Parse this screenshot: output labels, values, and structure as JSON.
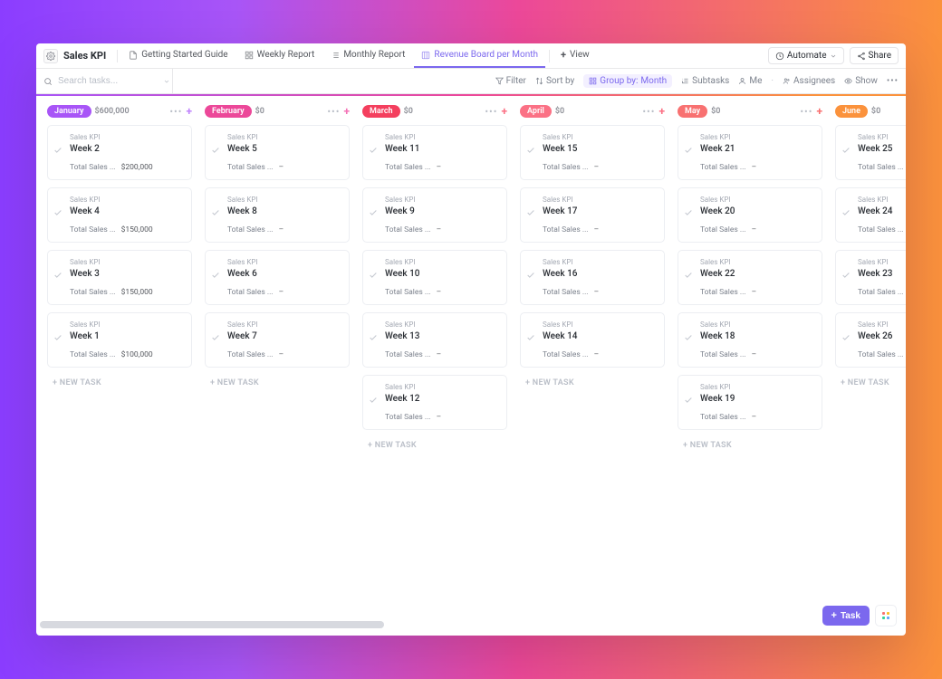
{
  "title": "Sales KPI",
  "tabs": [
    {
      "label": "Getting Started Guide",
      "active": false
    },
    {
      "label": "Weekly Report",
      "active": false
    },
    {
      "label": "Monthly Report",
      "active": false
    },
    {
      "label": "Revenue Board per Month",
      "active": true
    },
    {
      "label": "View",
      "active": false,
      "is_add": true
    }
  ],
  "top_right": {
    "automate": "Automate",
    "share": "Share"
  },
  "search": {
    "placeholder": "Search tasks..."
  },
  "toolbar": {
    "filter": "Filter",
    "sort": "Sort by",
    "group_prefix": "Group by:",
    "group_value": "Month",
    "subtasks": "Subtasks",
    "me": "Me",
    "assignees": "Assignees",
    "show": "Show"
  },
  "new_task_label": "+ NEW TASK",
  "task_fab": "Task",
  "columns": [
    {
      "name": "January",
      "amount": "$600,000",
      "color": "#a855f7",
      "plus": "#c084fc",
      "cards": [
        {
          "crumb": "Sales KPI",
          "title": "Week 2",
          "kvk": "Total Sales ...",
          "kvv": "$200,000"
        },
        {
          "crumb": "Sales KPI",
          "title": "Week 4",
          "kvk": "Total Sales ...",
          "kvv": "$150,000"
        },
        {
          "crumb": "Sales KPI",
          "title": "Week 3",
          "kvk": "Total Sales ...",
          "kvv": "$150,000"
        },
        {
          "crumb": "Sales KPI",
          "title": "Week 1",
          "kvk": "Total Sales ...",
          "kvv": "$100,000"
        }
      ],
      "show_new": true
    },
    {
      "name": "February",
      "amount": "$0",
      "color": "#ec4899",
      "plus": "#f472b6",
      "cards": [
        {
          "crumb": "Sales KPI",
          "title": "Week 5",
          "kvk": "Total Sales ...",
          "kvv": "–"
        },
        {
          "crumb": "Sales KPI",
          "title": "Week 8",
          "kvk": "Total Sales ...",
          "kvv": "–"
        },
        {
          "crumb": "Sales KPI",
          "title": "Week 6",
          "kvk": "Total Sales ...",
          "kvv": "–"
        },
        {
          "crumb": "Sales KPI",
          "title": "Week 7",
          "kvk": "Total Sales ...",
          "kvv": "–"
        }
      ],
      "show_new": true
    },
    {
      "name": "March",
      "amount": "$0",
      "color": "#f43f5e",
      "plus": "#fb7185",
      "cards": [
        {
          "crumb": "Sales KPI",
          "title": "Week 11",
          "kvk": "Total Sales ...",
          "kvv": "–"
        },
        {
          "crumb": "Sales KPI",
          "title": "Week 9",
          "kvk": "Total Sales ...",
          "kvv": "–"
        },
        {
          "crumb": "Sales KPI",
          "title": "Week 10",
          "kvk": "Total Sales ...",
          "kvv": "–"
        },
        {
          "crumb": "Sales KPI",
          "title": "Week 13",
          "kvk": "Total Sales ...",
          "kvv": "–"
        },
        {
          "crumb": "Sales KPI",
          "title": "Week 12",
          "kvk": "Total Sales ...",
          "kvv": "–"
        }
      ],
      "show_new": true
    },
    {
      "name": "April",
      "amount": "$0",
      "color": "#fb7185",
      "plus": "#fb7185",
      "cards": [
        {
          "crumb": "Sales KPI",
          "title": "Week 15",
          "kvk": "Total Sales ...",
          "kvv": "–"
        },
        {
          "crumb": "Sales KPI",
          "title": "Week 17",
          "kvk": "Total Sales ...",
          "kvv": "–"
        },
        {
          "crumb": "Sales KPI",
          "title": "Week 16",
          "kvk": "Total Sales ...",
          "kvv": "–"
        },
        {
          "crumb": "Sales KPI",
          "title": "Week 14",
          "kvk": "Total Sales ...",
          "kvv": "–"
        }
      ],
      "show_new": true
    },
    {
      "name": "May",
      "amount": "$0",
      "color": "#f87171",
      "plus": "#f87171",
      "cards": [
        {
          "crumb": "Sales KPI",
          "title": "Week 21",
          "kvk": "Total Sales ...",
          "kvv": "–"
        },
        {
          "crumb": "Sales KPI",
          "title": "Week 20",
          "kvk": "Total Sales ...",
          "kvv": "–"
        },
        {
          "crumb": "Sales KPI",
          "title": "Week 22",
          "kvk": "Total Sales ...",
          "kvv": "–"
        },
        {
          "crumb": "Sales KPI",
          "title": "Week 18",
          "kvk": "Total Sales ...",
          "kvv": "–"
        },
        {
          "crumb": "Sales KPI",
          "title": "Week 19",
          "kvk": "Total Sales ...",
          "kvv": "–"
        }
      ],
      "show_new": true
    },
    {
      "name": "June",
      "amount": "$0",
      "color": "#fb923c",
      "plus": "#fb923c",
      "cards": [
        {
          "crumb": "Sales KPI",
          "title": "Week 25",
          "kvk": "Total Sales ...",
          "kvv": ""
        },
        {
          "crumb": "Sales KPI",
          "title": "Week 24",
          "kvk": "Total Sales ...",
          "kvv": ""
        },
        {
          "crumb": "Sales KPI",
          "title": "Week 23",
          "kvk": "Total Sales ...",
          "kvv": ""
        },
        {
          "crumb": "Sales KPI",
          "title": "Week 26",
          "kvk": "Total Sales ...",
          "kvv": ""
        }
      ],
      "show_new": true
    }
  ]
}
